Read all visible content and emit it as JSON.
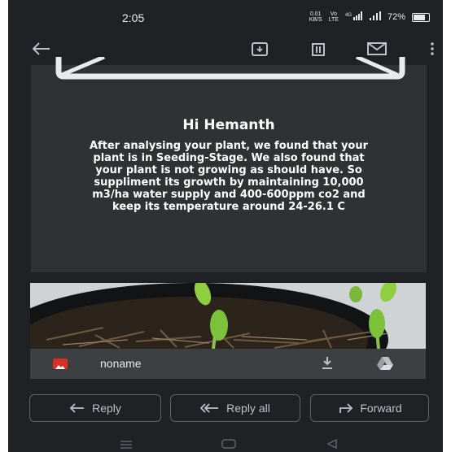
{
  "status": {
    "time": "2:05",
    "speed_top": "0.01",
    "speed_bottom": "KB/S",
    "vo_top": "Vo",
    "vo_bottom": "LTE",
    "signal": "⁴⁶ᴳ",
    "battery": "72%"
  },
  "toolbar": {
    "back_icon": "arrow-left-icon",
    "archive_icon": "archive-icon",
    "delete_icon": "trash-icon",
    "mail_icon": "mail-icon",
    "more_icon": "more-vert-icon"
  },
  "email": {
    "greeting": "Hi Hemanth",
    "message": "After analysing your plant, we found that your plant is in Seeding-Stage. We also found that your plant is not growing as should have. So suppliment its growth by maintaining 10,000 m3/ha water supply and 400-600ppm co2 and keep its temperature around 24-26.1 C"
  },
  "attachment": {
    "name": "noname"
  },
  "actions": {
    "reply": "Reply",
    "reply_all": "Reply all",
    "forward": "Forward"
  }
}
